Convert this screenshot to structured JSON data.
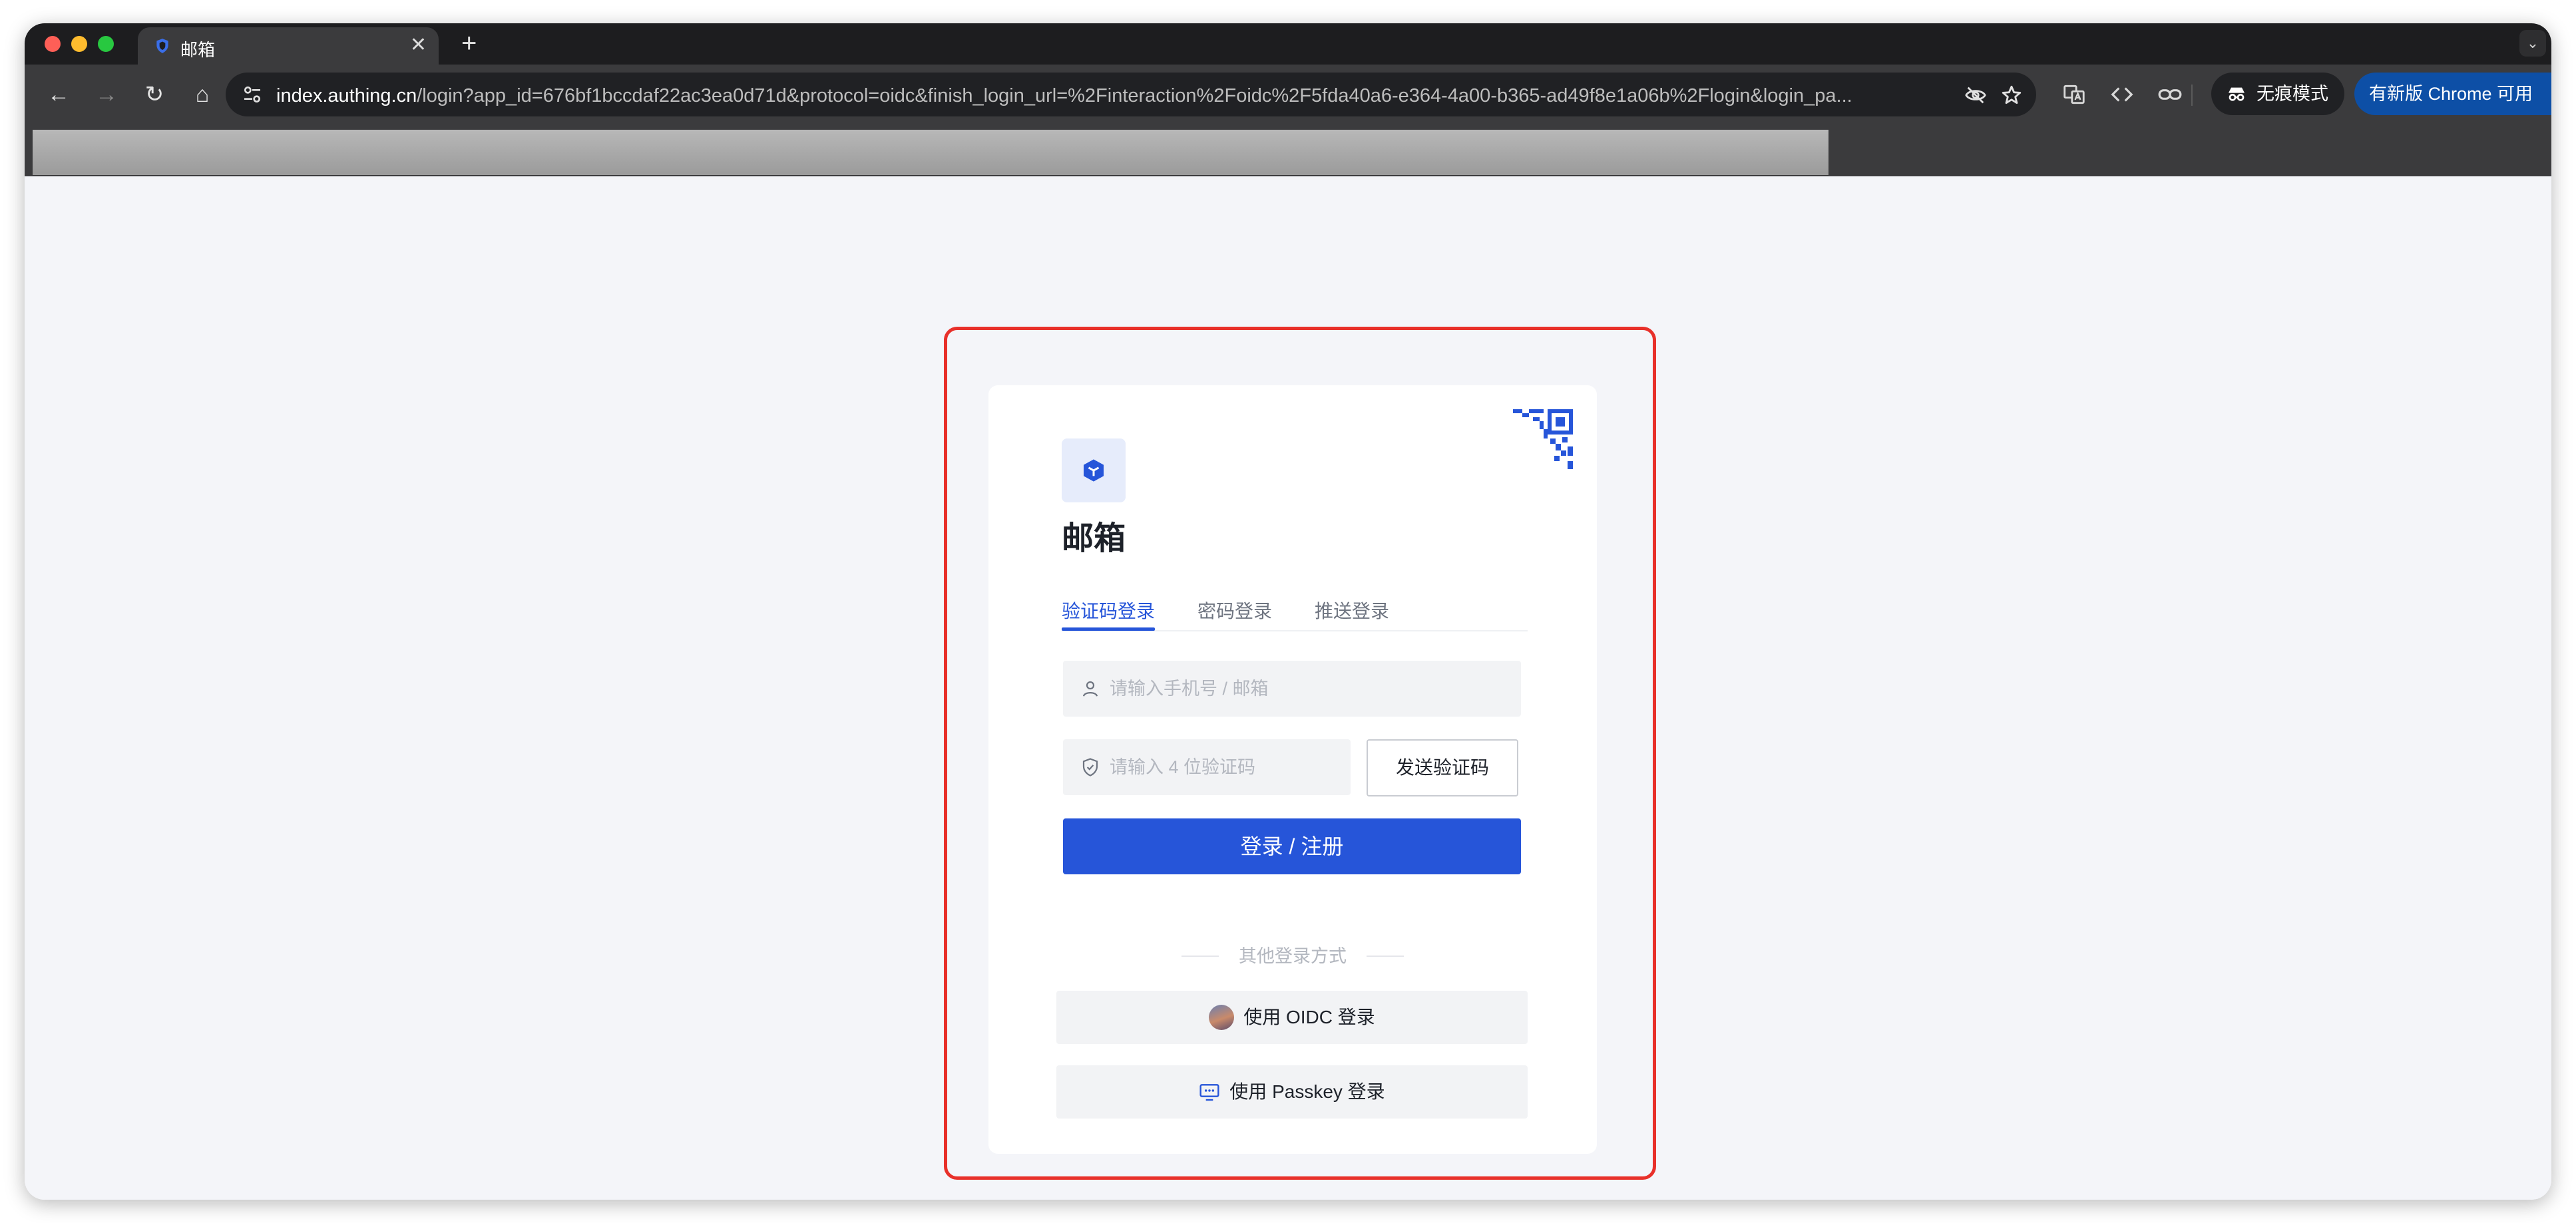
{
  "browser": {
    "tab": {
      "title": "邮箱",
      "close_glyph": "✕"
    },
    "new_tab_glyph": "+",
    "menu_glyph": "⌄",
    "nav": {
      "back_glyph": "←",
      "forward_glyph": "→",
      "reload_glyph": "↻",
      "home_glyph": "⌂"
    },
    "url_host": "index.authing.cn",
    "url_rest": "/login?app_id=676bf1bccdaf22ac3ea0d71d&protocol=oidc&finish_login_url=%2Finteraction%2Foidc%2F5fda40a6-e364-4a00-b365-ad49f8e1a06b%2Flogin&login_pa...",
    "omnibox_icons": [
      "eye-off-icon",
      "star-icon"
    ],
    "toolbar_icons": [
      "translate-icon",
      "code-icon",
      "link-icon"
    ],
    "incognito_label": "无痕模式",
    "update_label": "有新版 Chrome 可用"
  },
  "login": {
    "app_title": "邮箱",
    "tabs": [
      "验证码登录",
      "密码登录",
      "推送登录"
    ],
    "active_tab_index": 0,
    "account_placeholder": "请输入手机号 / 邮箱",
    "code_placeholder": "请输入 4 位验证码",
    "send_code_label": "发送验证码",
    "submit_label": "登录 / 注册",
    "divider_text": "其他登录方式",
    "oidc_label": "使用 OIDC 登录",
    "passkey_label": "使用 Passkey 登录"
  },
  "colors": {
    "primary": "#2655d9",
    "highlight_border": "#e8302a",
    "page_background": "#f4f5f9"
  }
}
